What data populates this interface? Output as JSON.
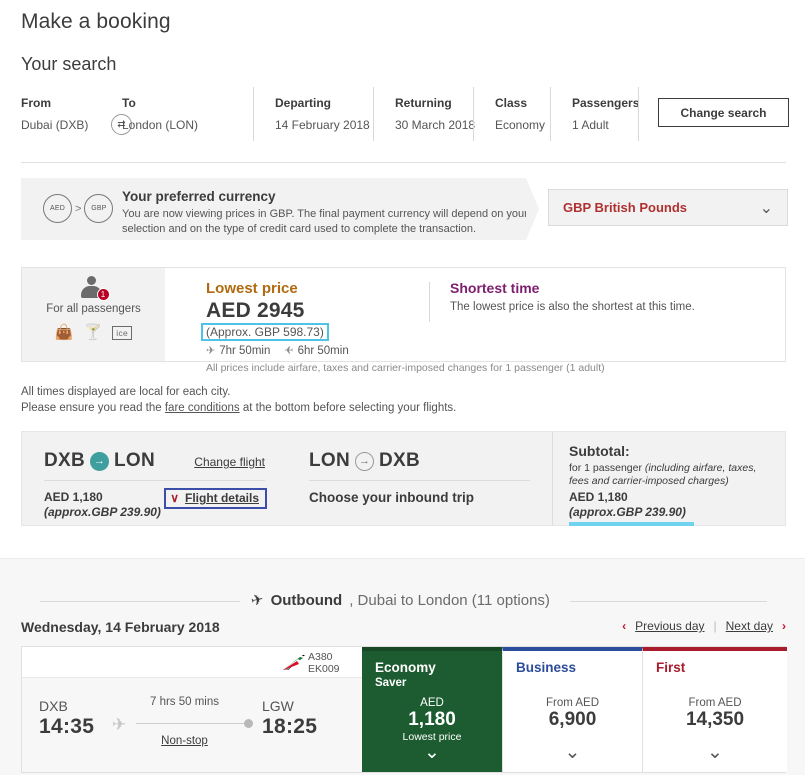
{
  "page": {
    "title": "Make a booking",
    "subtitle": "Your search"
  },
  "search": {
    "from_label": "From",
    "from_value": "Dubai (DXB)",
    "swap_icon": "⇄",
    "to_label": "To",
    "to_value": "London (LON)",
    "departing_label": "Departing",
    "departing_value": "14 February 2018",
    "returning_label": "Returning",
    "returning_value": "30 March 2018",
    "class_label": "Class",
    "class_value": "Economy",
    "passengers_label": "Passengers",
    "passengers_value": "1 Adult",
    "change_search": "Change search"
  },
  "currency": {
    "from_code": "AED",
    "gt": ">",
    "to_code": "GBP",
    "title": "Your preferred currency",
    "description": "You are now viewing prices in GBP. The final payment currency will depend on your selection and on the type of credit card used to complete the transaction.",
    "selected": "GBP British Pounds",
    "chevron": "⌄"
  },
  "lowest_price": {
    "pax_badge": "1",
    "pax_label": "For all passengers",
    "amenity_bag": "👜",
    "amenity_meal": "🍸",
    "amenity_ice": "ice",
    "title": "Lowest price",
    "amount": "AED 2945",
    "approx": "(Approx. GBP 598.73)",
    "outbound_duration": "7hr 50min",
    "inbound_duration": "6hr 50min",
    "note": "All prices include airfare, taxes and carrier-imposed changes for 1 passenger (1 adult)",
    "shortest_title": "Shortest time",
    "shortest_desc": "The lowest price is also the shortest at this time."
  },
  "notes": {
    "line1": "All times displayed are local for each city.",
    "line2_before": "Please ensure you read the ",
    "line2_link": "fare conditions",
    "line2_after": " at the bottom before selecting your flights."
  },
  "trip": {
    "outbound": {
      "from": "DXB",
      "arrow": "→",
      "to": "LON",
      "change_flight": "Change flight",
      "fare": "AED 1,180",
      "fare_approx": "(approx.GBP 239.90)",
      "details_chevron": "∨",
      "details_label": "Flight details"
    },
    "inbound": {
      "from": "LON",
      "arrow": "→",
      "to": "DXB",
      "prompt": "Choose your inbound trip"
    },
    "subtotal": {
      "title": "Subtotal:",
      "desc_before": "for 1 passenger ",
      "desc_italic": "(including airfare, taxes, fees and carrier-imposed charges)",
      "amount": "AED 1,180",
      "approx": "(approx.GBP 239.90)"
    }
  },
  "outbound_section": {
    "plane_icon": "✈",
    "title_bold": "Outbound",
    "title_rest": ", Dubai to London (11 options)",
    "date": "Wednesday, 14 February 2018",
    "prev_caret": "‹",
    "prev_day": "Previous day",
    "separator": "|",
    "next_day": "Next day",
    "next_caret": "›"
  },
  "flight": {
    "aircraft": "A380",
    "flight_number": "EK009",
    "depart_code": "DXB",
    "depart_time": "14:35",
    "duration": "7 hrs 50 mins",
    "stops": "Non-stop",
    "arrive_code": "LGW",
    "arrive_time": "18:25",
    "plane_icon": "✈",
    "fares": [
      {
        "name": "Economy",
        "sub": "Saver",
        "currency": "AED",
        "amount": "1,180",
        "tag": "Lowest price",
        "chevron": "⌄"
      },
      {
        "name": "Business",
        "sub": "",
        "currency": "From AED",
        "amount": "6,900",
        "tag": "",
        "chevron": "⌄"
      },
      {
        "name": "First",
        "sub": "",
        "currency": "From AED",
        "amount": "14,350",
        "tag": "",
        "chevron": "⌄"
      }
    ]
  },
  "colors": {
    "accent_red": "#c8102e",
    "economy_green": "#1d5c30",
    "business_blue": "#2c4d9b",
    "first_red": "#a81c2c",
    "lowest_price_amber": "#b06a10",
    "shortest_purple": "#7d1e6e",
    "highlight_cyan": "#4ec3e8",
    "focus_blue": "#3b4ea8"
  }
}
